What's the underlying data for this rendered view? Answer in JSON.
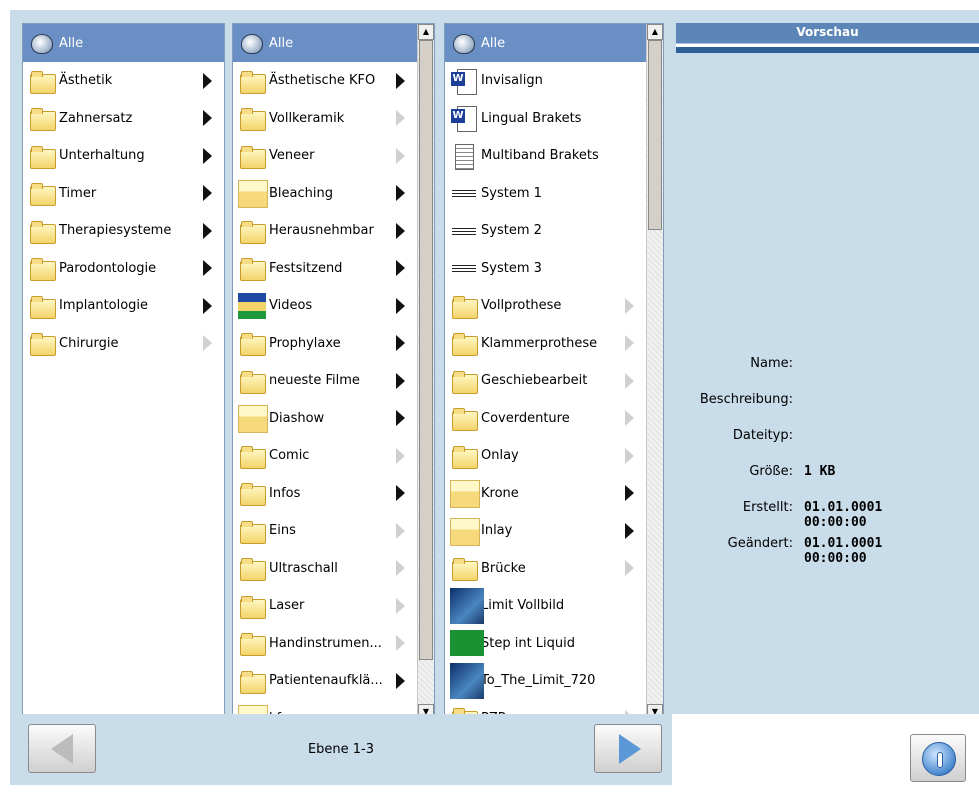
{
  "column1": {
    "items": [
      {
        "label": "Alle",
        "icon": "all-icon",
        "selected": true,
        "arrow": "none"
      },
      {
        "label": "Ästhetik",
        "icon": "folder-icon",
        "arrow": "dark"
      },
      {
        "label": "Zahnersatz",
        "icon": "folder-icon",
        "arrow": "dark"
      },
      {
        "label": "Unterhaltung",
        "icon": "folder-icon",
        "arrow": "dark"
      },
      {
        "label": "Timer",
        "icon": "folder-icon",
        "arrow": "dark"
      },
      {
        "label": "Therapiesysteme",
        "icon": "folder-icon",
        "arrow": "dark"
      },
      {
        "label": "Parodontologie",
        "icon": "folder-icon",
        "arrow": "dark"
      },
      {
        "label": "Implantologie",
        "icon": "folder-icon",
        "arrow": "dark"
      },
      {
        "label": "Chirurgie",
        "icon": "folder-icon",
        "arrow": "light"
      }
    ]
  },
  "column2": {
    "items": [
      {
        "label": "Alle",
        "icon": "all-icon",
        "selected": true,
        "arrow": "none"
      },
      {
        "label": "Ästhetische KFO",
        "icon": "folder-icon",
        "arrow": "dark"
      },
      {
        "label": "Vollkeramik",
        "icon": "folder-icon",
        "arrow": "light"
      },
      {
        "label": "Veneer",
        "icon": "folder-icon",
        "arrow": "light"
      },
      {
        "label": "Bleaching",
        "icon": "thumb-icon",
        "arrow": "dark"
      },
      {
        "label": "Herausnehmbar",
        "icon": "folder-icon",
        "arrow": "dark"
      },
      {
        "label": "Festsitzend",
        "icon": "folder-icon",
        "arrow": "dark"
      },
      {
        "label": "Videos",
        "icon": "video-icon",
        "arrow": "dark"
      },
      {
        "label": "Prophylaxe",
        "icon": "folder-icon",
        "arrow": "dark"
      },
      {
        "label": "neueste Filme",
        "icon": "folder-icon",
        "arrow": "dark"
      },
      {
        "label": "Diashow",
        "icon": "thumb-icon",
        "arrow": "dark"
      },
      {
        "label": "Comic",
        "icon": "folder-icon",
        "arrow": "light"
      },
      {
        "label": "Infos",
        "icon": "folder-icon",
        "arrow": "dark"
      },
      {
        "label": "Eins",
        "icon": "folder-icon",
        "arrow": "light"
      },
      {
        "label": "Ultraschall",
        "icon": "folder-icon",
        "arrow": "light"
      },
      {
        "label": "Laser",
        "icon": "folder-icon",
        "arrow": "light"
      },
      {
        "label": "Handinstrumen...",
        "icon": "folder-icon",
        "arrow": "light"
      },
      {
        "label": "Patientenaufklä...",
        "icon": "folder-icon",
        "arrow": "dark"
      },
      {
        "label": "kf",
        "icon": "thumb-icon",
        "arrow": "none"
      }
    ]
  },
  "column3": {
    "items": [
      {
        "label": "Alle",
        "icon": "all-icon",
        "selected": true,
        "arrow": "none"
      },
      {
        "label": "Invisalign",
        "icon": "word-icon",
        "arrow": "none"
      },
      {
        "label": "Lingual Brakets",
        "icon": "word-icon",
        "arrow": "none"
      },
      {
        "label": "Multiband Brakets",
        "icon": "doc-icon",
        "arrow": "none"
      },
      {
        "label": "System 1",
        "icon": "sys-icon",
        "arrow": "none"
      },
      {
        "label": "System 2",
        "icon": "sys-icon",
        "arrow": "none"
      },
      {
        "label": "System 3",
        "icon": "sys-icon",
        "arrow": "none"
      },
      {
        "label": "Vollprothese",
        "icon": "folder-icon",
        "arrow": "light"
      },
      {
        "label": "Klammerprothese",
        "icon": "folder-icon",
        "arrow": "light"
      },
      {
        "label": "Geschiebearbeit",
        "icon": "folder-icon",
        "arrow": "light"
      },
      {
        "label": "Coverdenture",
        "icon": "folder-icon",
        "arrow": "light"
      },
      {
        "label": "Onlay",
        "icon": "folder-icon",
        "arrow": "light"
      },
      {
        "label": "Krone",
        "icon": "thumb-icon",
        "arrow": "dark"
      },
      {
        "label": "Inlay",
        "icon": "thumb-icon",
        "arrow": "dark"
      },
      {
        "label": "Brücke",
        "icon": "folder-icon",
        "arrow": "light"
      },
      {
        "label": "Limit Vollbild",
        "icon": "movie-icon",
        "arrow": "none"
      },
      {
        "label": "Step int Liquid",
        "icon": "green-icon",
        "arrow": "none"
      },
      {
        "label": "To_The_Limit_720",
        "icon": "movie-icon",
        "arrow": "none"
      },
      {
        "label": "PZP",
        "icon": "folder-icon",
        "arrow": "light"
      }
    ]
  },
  "preview": {
    "title": "Vorschau",
    "fields": [
      {
        "label": "Name:",
        "value": ""
      },
      {
        "label": "Beschreibung:",
        "value": ""
      },
      {
        "label": "Dateityp:",
        "value": ""
      },
      {
        "label": "Größe:",
        "value": "1 KB"
      },
      {
        "label": "Erstellt:",
        "value": "01.01.0001\n00:00:00"
      },
      {
        "label": "Geändert:",
        "value": "01.01.0001\n00:00:00"
      }
    ]
  },
  "navigation": {
    "level_label": "Ebene 1-3"
  },
  "colors": {
    "selection": "#6a8fc5",
    "panel_background": "#c9dce9",
    "header_blue": "#2e5f95"
  }
}
